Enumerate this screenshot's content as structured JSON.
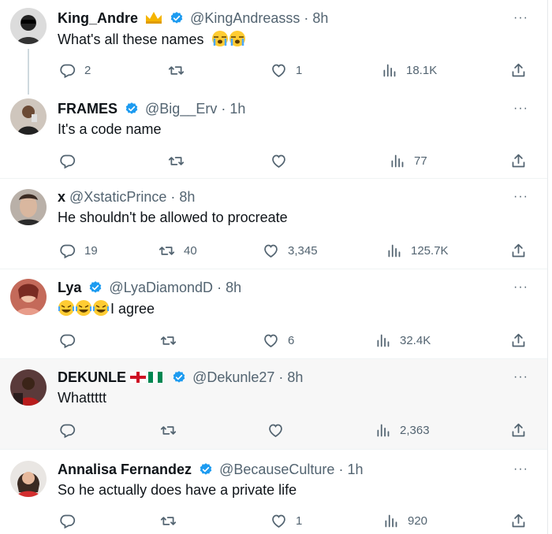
{
  "tweets": [
    {
      "name": "King_Andre",
      "handle": "@KingAndreasss",
      "time": "· 8h",
      "text": "What's all these names",
      "reply_count": "2",
      "retweet_count": "",
      "like_count": "1",
      "views": "18.1K"
    },
    {
      "name": "FRAMES",
      "handle": "@Big__Erv",
      "time": "· 1h",
      "text": "It's a code name",
      "reply_count": "",
      "retweet_count": "",
      "like_count": "",
      "views": "77"
    },
    {
      "name": "x",
      "handle": "@XstaticPrince",
      "time": "· 8h",
      "text": "He shouldn't be allowed to procreate",
      "reply_count": "19",
      "retweet_count": "40",
      "like_count": "3,345",
      "views": "125.7K"
    },
    {
      "name": "Lya",
      "handle": "@LyaDiamondD",
      "time": "· 8h",
      "text": "I agree",
      "reply_count": "",
      "retweet_count": "",
      "like_count": "6",
      "views": "32.4K"
    },
    {
      "name": "DEKUNLE",
      "handle": "@Dekunle27",
      "time": "· 8h",
      "text": "Whattttt",
      "reply_count": "",
      "retweet_count": "",
      "like_count": "",
      "views": "2,363"
    },
    {
      "name": "Annalisa Fernandez",
      "handle": "@BecauseCulture",
      "time": "· 1h",
      "text": "So he actually does have a private life",
      "reply_count": "",
      "retweet_count": "",
      "like_count": "1",
      "views": "920"
    }
  ],
  "more_label": "···",
  "colors": {
    "verified": "#1d9bf0",
    "muted": "#536471",
    "highlight": "#f7f7f7"
  }
}
